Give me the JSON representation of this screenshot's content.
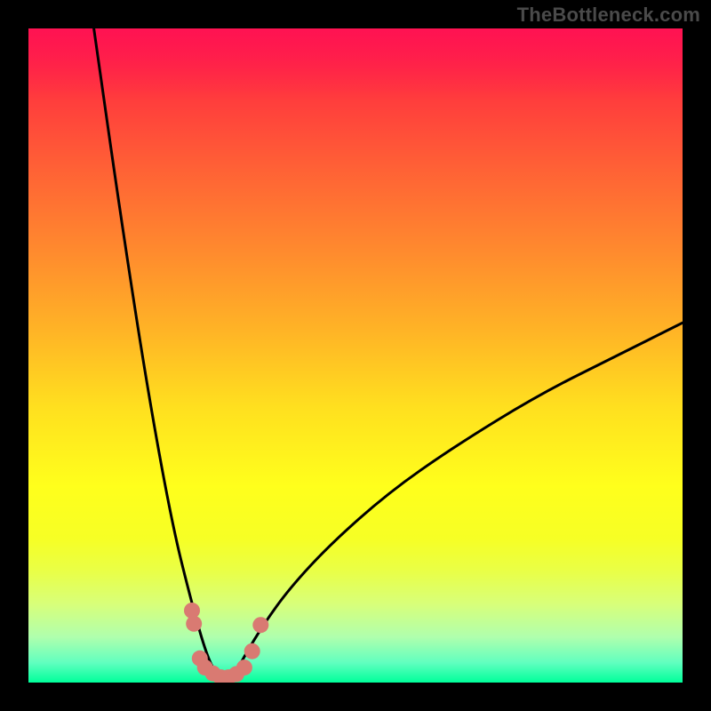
{
  "watermark": "TheBottleneck.com",
  "chart_data": {
    "type": "line",
    "title": "",
    "xlabel": "",
    "ylabel": "",
    "xlim": [
      0,
      100
    ],
    "ylim": [
      0,
      100
    ],
    "grid": false,
    "legend": false,
    "notes": "Bottleneck-style V curve over rainbow gradient. Minimum (green) near x≈28–33. Left branch rises steeply to y≈100 at x≈10; right branch rises to y≈55 at x=100. Salmon dot markers cluster near the trough.",
    "series": [
      {
        "name": "bottleneck-curve",
        "x": [
          10,
          14,
          18,
          22,
          25,
          27,
          28.5,
          30,
          31.5,
          33,
          36,
          40,
          46,
          55,
          65,
          78,
          90,
          100
        ],
        "y": [
          100,
          72,
          46,
          24,
          12,
          5,
          1.5,
          0.5,
          1.2,
          4,
          9,
          14.5,
          21,
          29,
          36,
          44,
          50,
          55
        ]
      }
    ],
    "markers": {
      "name": "trough-dots",
      "color": "#d97a72",
      "points": [
        {
          "x": 25.0,
          "y": 11.0
        },
        {
          "x": 25.3,
          "y": 9.0
        },
        {
          "x": 26.2,
          "y": 3.7
        },
        {
          "x": 27.0,
          "y": 2.3
        },
        {
          "x": 28.2,
          "y": 1.4
        },
        {
          "x": 29.4,
          "y": 0.8
        },
        {
          "x": 30.6,
          "y": 0.8
        },
        {
          "x": 31.8,
          "y": 1.3
        },
        {
          "x": 33.0,
          "y": 2.3
        },
        {
          "x": 34.2,
          "y": 4.8
        },
        {
          "x": 35.5,
          "y": 8.8
        }
      ]
    },
    "gradient_stops": [
      {
        "pos": 0.0,
        "color": "#ff1648"
      },
      {
        "pos": 0.1,
        "color": "#ff3a3d"
      },
      {
        "pos": 0.22,
        "color": "#ff6335"
      },
      {
        "pos": 0.34,
        "color": "#ff8a2e"
      },
      {
        "pos": 0.46,
        "color": "#ffb326"
      },
      {
        "pos": 0.58,
        "color": "#ffe01f"
      },
      {
        "pos": 0.7,
        "color": "#ffff1c"
      },
      {
        "pos": 0.83,
        "color": "#e9ff47"
      },
      {
        "pos": 0.93,
        "color": "#b0ffad"
      },
      {
        "pos": 1.0,
        "color": "#00ff9a"
      }
    ]
  }
}
